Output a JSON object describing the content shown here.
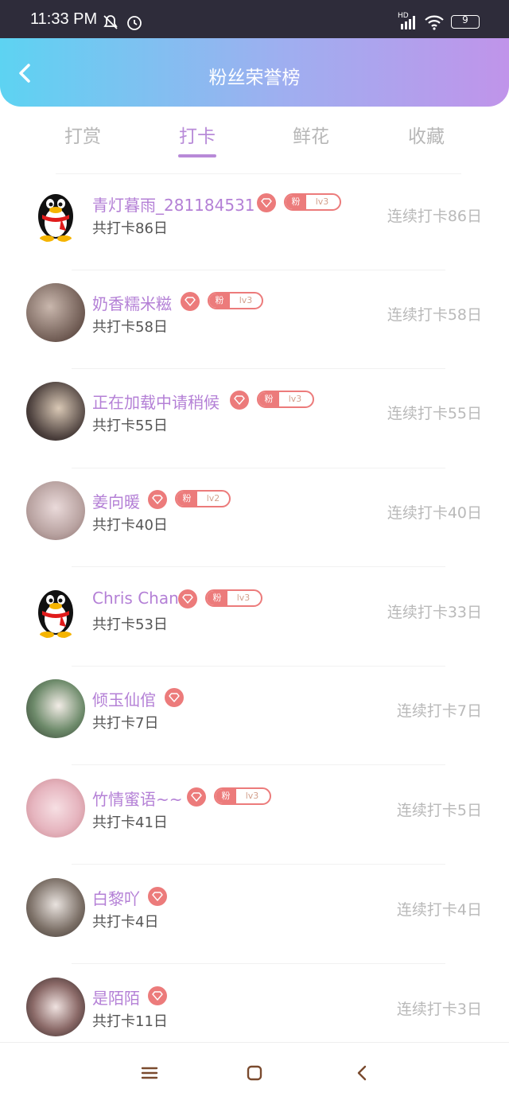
{
  "status_bar": {
    "time": "11:33 PM",
    "network": "HD",
    "battery": "9",
    "icons": [
      "mute-icon",
      "alarm-icon",
      "signal-icon",
      "wifi-icon",
      "battery-icon"
    ]
  },
  "header": {
    "title": "粉丝荣誉榜",
    "back_icon": "chevron-left-icon"
  },
  "tabs": [
    {
      "label": "打赏"
    },
    {
      "label": "打卡",
      "active": true
    },
    {
      "label": "鲜花"
    },
    {
      "label": "收藏"
    }
  ],
  "rows": [
    {
      "name": "青灯暮雨_281184531",
      "total": "共打卡86日",
      "streak": "连续打卡86日",
      "fan": "粉",
      "level": "lv3",
      "avatar": "penguin"
    },
    {
      "name": "奶香糯米糍",
      "total": "共打卡58日",
      "streak": "连续打卡58日",
      "fan": "粉",
      "level": "lv3",
      "avatar": "photo"
    },
    {
      "name": "正在加载中请稍候",
      "total": "共打卡55日",
      "streak": "连续打卡55日",
      "fan": "粉",
      "level": "lv3",
      "avatar": "photo"
    },
    {
      "name": "姜向暖",
      "total": "共打卡40日",
      "streak": "连续打卡40日",
      "fan": "粉",
      "level": "lv2",
      "avatar": "photo"
    },
    {
      "name": "Chris Chan",
      "total": "共打卡53日",
      "streak": "连续打卡33日",
      "fan": "粉",
      "level": "lv3",
      "avatar": "penguin"
    },
    {
      "name": "倾玉仙倌",
      "total": "共打卡7日",
      "streak": "连续打卡7日",
      "avatar": "photo"
    },
    {
      "name": "竹情蜜语~~",
      "total": "共打卡41日",
      "streak": "连续打卡5日",
      "fan": "粉",
      "level": "lv3",
      "avatar": "photo"
    },
    {
      "name": "白黎吖",
      "total": "共打卡4日",
      "streak": "连续打卡4日",
      "avatar": "photo"
    },
    {
      "name": "是陌陌",
      "total": "共打卡11日",
      "streak": "连续打卡3日",
      "avatar": "photo"
    }
  ],
  "nav": {
    "icons": [
      "menu-icon",
      "home-square-icon",
      "back-arrow-icon"
    ]
  },
  "colors": {
    "accent": "#b88ad8",
    "badge": "#ec7b7b"
  }
}
